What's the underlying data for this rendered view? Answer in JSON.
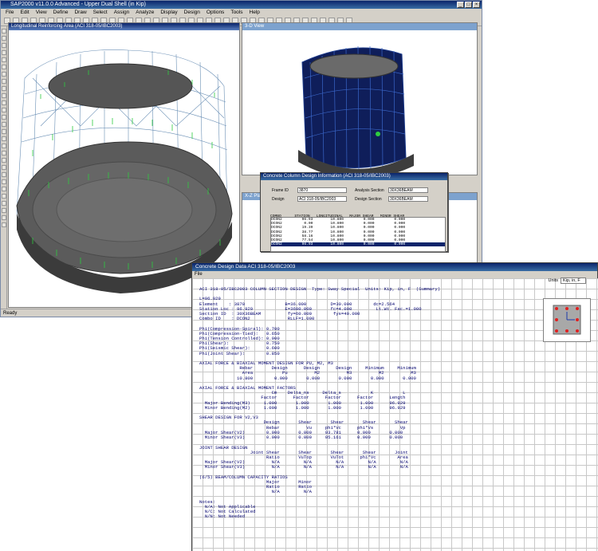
{
  "app": {
    "title": "SAP2000 v11.0.0 Advanced  - Upper Dual Shell (in Kip)",
    "menu": [
      "File",
      "Edit",
      "View",
      "Define",
      "Draw",
      "Select",
      "Assign",
      "Analyze",
      "Display",
      "Design",
      "Options",
      "Tools",
      "Help"
    ],
    "status": "Ready"
  },
  "windows": {
    "left_title": "Longitudinal Reinforcing Area  (ACI 318-05/IBC2003)",
    "right_title": "3-D View",
    "mid_title": "X-Z Plane"
  },
  "dialog1": {
    "title": "Concrete Column Design Information  (ACI 318-05/IBC2003)",
    "frame_id_label": "Frame ID",
    "frame_id": "3870",
    "design_label": "Design",
    "design_code": "ACI 318-05/IBC2003",
    "analysis_section_label": "Analysis Section",
    "analysis_section": "30X36BEAM",
    "design_section_label": "Design Section",
    "design_section": "30X36BEAM",
    "list_header1": "COMBO      STATION   LONGITUDINAL   MAJOR SHEAR   MINOR SHEAR",
    "list_header2": "ID           LOC  REINFORCEMENT REINFORCEMENT REINFORCEMENT",
    "rows": [
      "DCON2         96.93        10.800         0.000         0.000",
      "DCON2          0.00        10.800         0.000         0.000",
      "DCON2         19.39        10.800         0.000         0.000",
      "DCON2         38.77        10.800         0.000         0.000",
      "DCON2         58.16        10.800         0.000         0.000",
      "DCON2         77.54        10.800         0.000         0.000",
      "DCON2         96.93        10.800         0.000         0.000"
    ]
  },
  "dialog2": {
    "title": "Concrete Design Data  ACI 318-05/IBC2003",
    "menu": "File",
    "units_label": "Units",
    "units_value": "Kip, in, F",
    "report": "ACI 318-05/IBC2003 COLUMN SECTION DESIGN  Type: Sway Special  Units: Kip, in, F  (Summary)\n\nL=96.929\nElement    : 3870               B=36.000         D=30.000        dc=2.564\nStation Loc : 96.929            E=3600.000       fc=4.000         Lt.Wt. Fac.=1.000\nSection ID  : 30X36BEAM          fy=60.000        fys=40.000\nCombo ID    : DCON2              RLLF=1.000\n\nPhi(Compression-Spiral): 0.700\nPhi(Compression-Tied):   0.650\nPhi(Tension Controlled): 0.900\nPhi(Shear):              0.750\nPhi(Seismic Shear):      0.600\nPhi(Joint Shear):        0.850\n\nAXIAL FORCE & BIAXIAL MOMENT DESIGN FOR PU, M2, M3\n               Rebar       Design      Design      Design     Minimum     Minimum\n                Area           Pu          M2          M3          M2          M3\n              10.800        0.000       0.000       0.000       0.000       0.000\n\nAXIAL FORCE & BIAXIAL MOMENT FACTORS\n                           Cm    Delta_ns     Delta_s           K           L\n                       Factor      Factor      Factor      Factor      Length\n  Major Bending(M3)     1.000       1.000       1.000       1.000      96.929\n  Minor Bending(M2)     1.000       1.000       1.000       1.000      96.929\n\nSHEAR DESIGN FOR V2,V3\n                        Design       Shear       Shear       Shear       Shear\n                         Rebar          Vu     phi*Vc      phi*Vs          Vp\n  Major Shear(V2)        0.000       0.000     93.781      0.000       0.000\n  Minor Shear(V3)        0.000       0.000     95.161      0.000       0.000\n\nJOINT SHEAR DESIGN\n                   Joint Shear       Shear       Shear       Shear       Joint\n                         Ratio       VuTop       VuTot      phi*Vc        Area\n  Major Shear(V2)          N/A         N/A         N/A         N/A         N/A\n  Minor Shear(V3)          N/A         N/A         N/A         N/A         N/A\n\n(6/5) BEAM/COLUMN CAPACITY RATIOS\n                         Major       Minor\n                         Ratio       Ratio\n                           N/A         N/A\n\nNotes:\n  N/A: Not Applicable\n  N/C: Not Calculated\n  N/N: Not Needed"
  }
}
